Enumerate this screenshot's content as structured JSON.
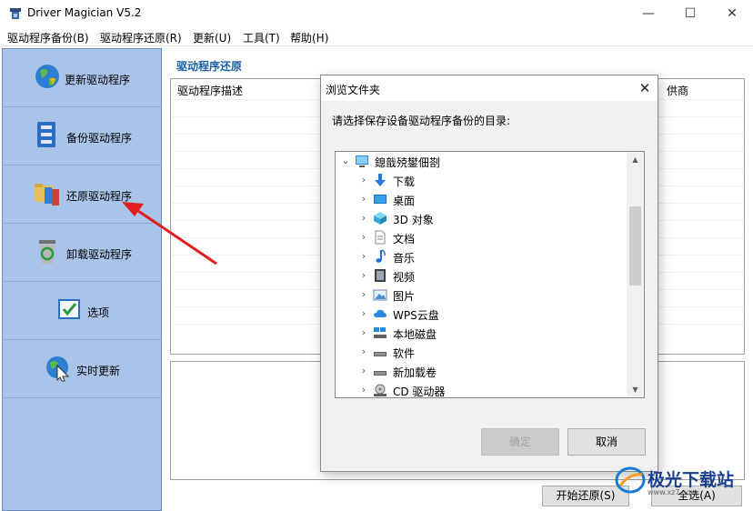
{
  "window": {
    "title": "Driver Magician V5.2",
    "min_glyph": "—",
    "max_glyph": "☐",
    "close_glyph": "✕"
  },
  "menu": [
    {
      "label": "驱动程序备份(B)"
    },
    {
      "label": "驱动程序还原(R)"
    },
    {
      "label": "更新(U)"
    },
    {
      "label": "工具(T)"
    },
    {
      "label": "帮助(H)"
    }
  ],
  "sidebar": {
    "items": [
      {
        "label": "更新驱动程序",
        "icon": "globe-update-icon"
      },
      {
        "label": "备份驱动程序",
        "icon": "backup-icon"
      },
      {
        "label": "还原驱动程序",
        "icon": "restore-icon"
      },
      {
        "label": "卸载驱动程序",
        "icon": "recycle-bin-icon"
      },
      {
        "label": "选项",
        "icon": "options-icon"
      },
      {
        "label": "实时更新",
        "icon": "live-update-icon"
      }
    ]
  },
  "main": {
    "section_title": "驱动程序还原",
    "columns": [
      "驱动程序描述",
      "供商"
    ],
    "buttons": {
      "start_restore": "开始还原(S)",
      "select_all": "全选(A)"
    }
  },
  "dialog": {
    "title": "浏览文件夹",
    "close_glyph": "✕",
    "prompt": "请选择保存设备驱动程序备份的目录:",
    "tree": [
      {
        "label": "鎴戠殑鐢佃剳",
        "icon": "computer-icon",
        "expand": "⌄",
        "level": 0
      },
      {
        "label": "下载",
        "icon": "download-icon",
        "expand": "›",
        "level": 1
      },
      {
        "label": "桌面",
        "icon": "desktop-icon",
        "expand": "›",
        "level": 1
      },
      {
        "label": "3D 对象",
        "icon": "3d-objects-icon",
        "expand": "›",
        "level": 1
      },
      {
        "label": "文档",
        "icon": "documents-icon",
        "expand": "›",
        "level": 1
      },
      {
        "label": "音乐",
        "icon": "music-icon",
        "expand": "›",
        "level": 1
      },
      {
        "label": "视频",
        "icon": "video-icon",
        "expand": "›",
        "level": 1
      },
      {
        "label": "图片",
        "icon": "pictures-icon",
        "expand": "›",
        "level": 1
      },
      {
        "label": "WPS云盘",
        "icon": "cloud-icon",
        "expand": "›",
        "level": 1
      },
      {
        "label": "本地磁盘",
        "icon": "local-disk-icon",
        "expand": "›",
        "level": 1
      },
      {
        "label": "软件",
        "icon": "drive-icon",
        "expand": "›",
        "level": 1
      },
      {
        "label": "新加载卷",
        "icon": "drive-icon",
        "expand": "›",
        "level": 1
      },
      {
        "label": "CD 驱动器",
        "icon": "cd-drive-icon",
        "expand": "›",
        "level": 1
      }
    ],
    "ok": "确定",
    "cancel": "取消"
  },
  "watermark": {
    "text": "极光下载站",
    "sub": "www.xz7.com"
  },
  "colors": {
    "sidebar_bg": "#a9c4e8",
    "section_title": "#1a5fa8",
    "annotation_arrow": "#e02020"
  }
}
